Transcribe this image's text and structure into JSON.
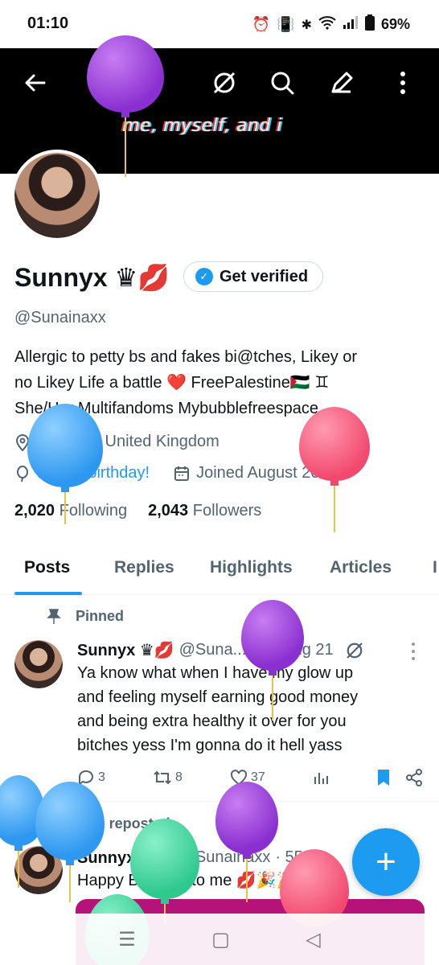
{
  "status_bar": {
    "time": "01:10",
    "battery": "69%",
    "icons": [
      "alarm-icon",
      "vibrate-icon",
      "bluetooth-icon",
      "wifi-icon",
      "signal-icon",
      "battery-icon"
    ]
  },
  "header": {
    "banner_text": "me, myself, and i",
    "buttons": [
      "back-arrow-icon",
      "grok-icon",
      "search-icon",
      "edit-icon",
      "more-vertical-icon"
    ]
  },
  "profile": {
    "name": "Sunnyx ♛💋",
    "get_verified_label": "Get verified",
    "handle": "@Sunainaxx",
    "bio_line1": "Allergic to petty bs and fakes bi@tches, Likey or",
    "bio_line2": "no Likey  Life a battle ❤️ FreePalestine🇵🇸   ♊",
    "bio_line3": "She/Her Multifandoms       Mybubblefreespace",
    "location": "England, United Kingdom",
    "birthday": "Happy birthday!",
    "joined": "Joined August 2012",
    "following_count": "2,020",
    "following_label": "Following",
    "followers_count": "2,043",
    "followers_label": "Followers"
  },
  "tabs": [
    {
      "label": "Posts",
      "active": true
    },
    {
      "label": "Replies",
      "active": false
    },
    {
      "label": "Highlights",
      "active": false
    },
    {
      "label": "Articles",
      "active": false
    },
    {
      "label": "I",
      "active": false
    }
  ],
  "tweets": [
    {
      "pinned_label": "Pinned",
      "name": "Sunnyx ♛💋",
      "handle": "@Suna...",
      "time": "· 17 Aug 21",
      "line1": "Ya know what when I have my glow up",
      "line2": "and feeling myself earning good money",
      "line3": "and being extra healthy it over for you",
      "line4": "bitches yess I'm gonna do it hell yass",
      "replies": "3",
      "retweets": "8",
      "likes": "37"
    },
    {
      "reposted_label": "You reposted",
      "name": "Sunnyx ♛💋",
      "handle": "@Sunainaxx",
      "time": "· 55m",
      "text": "Happy Birthday to me 💋🎉🎉"
    }
  ],
  "fab_label": "+",
  "nav_bar": {
    "recent": "☰",
    "home": "▢",
    "back": "◁"
  },
  "colors": {
    "accent": "#1d9bf0",
    "banner_bg": "#000000",
    "muted": "#536471",
    "balloon_purple": "#9b3fd9",
    "balloon_blue": "#3aa3f5",
    "balloon_pink": "#f7557a",
    "balloon_green": "#35d39b"
  }
}
